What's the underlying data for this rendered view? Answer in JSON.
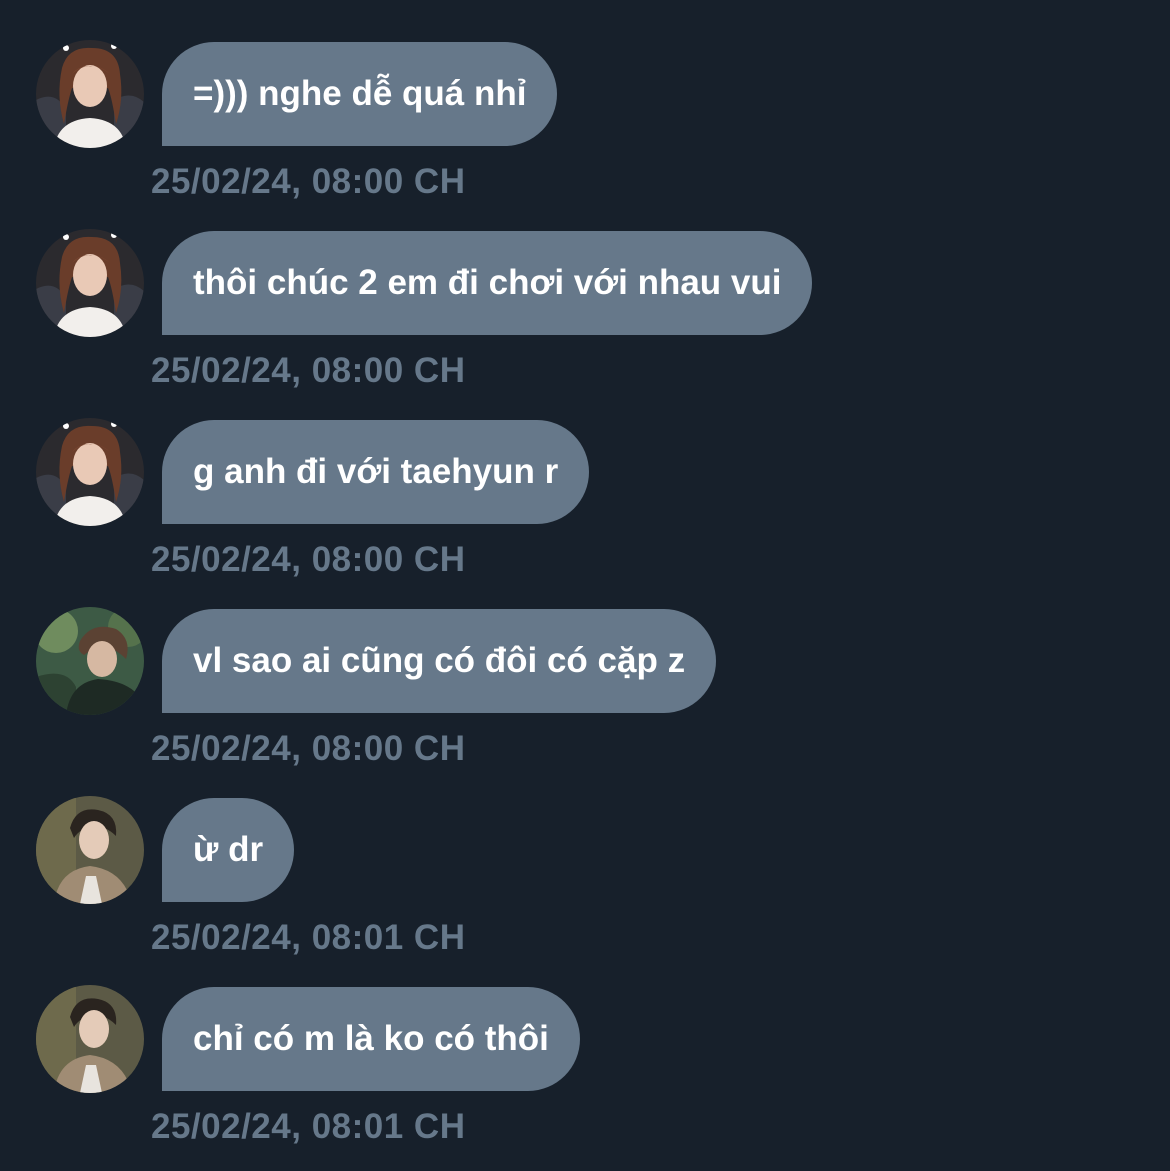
{
  "colors": {
    "background": "#17202b",
    "bubble": "#66788a",
    "bubble_text": "#ffffff",
    "timestamp": "#66788a"
  },
  "messages": [
    {
      "avatar": "avatar-user-1",
      "text": "=))) nghe dễ quá nhỉ",
      "time": "25/02/24, 08:00 CH"
    },
    {
      "avatar": "avatar-user-1",
      "text": "thôi chúc 2 em đi chơi với nhau vui",
      "time": "25/02/24, 08:00 CH"
    },
    {
      "avatar": "avatar-user-1",
      "text": "g anh đi với taehyun r",
      "time": "25/02/24, 08:00 CH"
    },
    {
      "avatar": "avatar-user-2",
      "text": "vl sao ai cũng có đôi có cặp z",
      "time": "25/02/24, 08:00 CH"
    },
    {
      "avatar": "avatar-user-3",
      "text": "ừ dr",
      "time": "25/02/24, 08:01 CH"
    },
    {
      "avatar": "avatar-user-3",
      "text": "chỉ có m là ko có thôi",
      "time": "25/02/24, 08:01 CH"
    }
  ]
}
